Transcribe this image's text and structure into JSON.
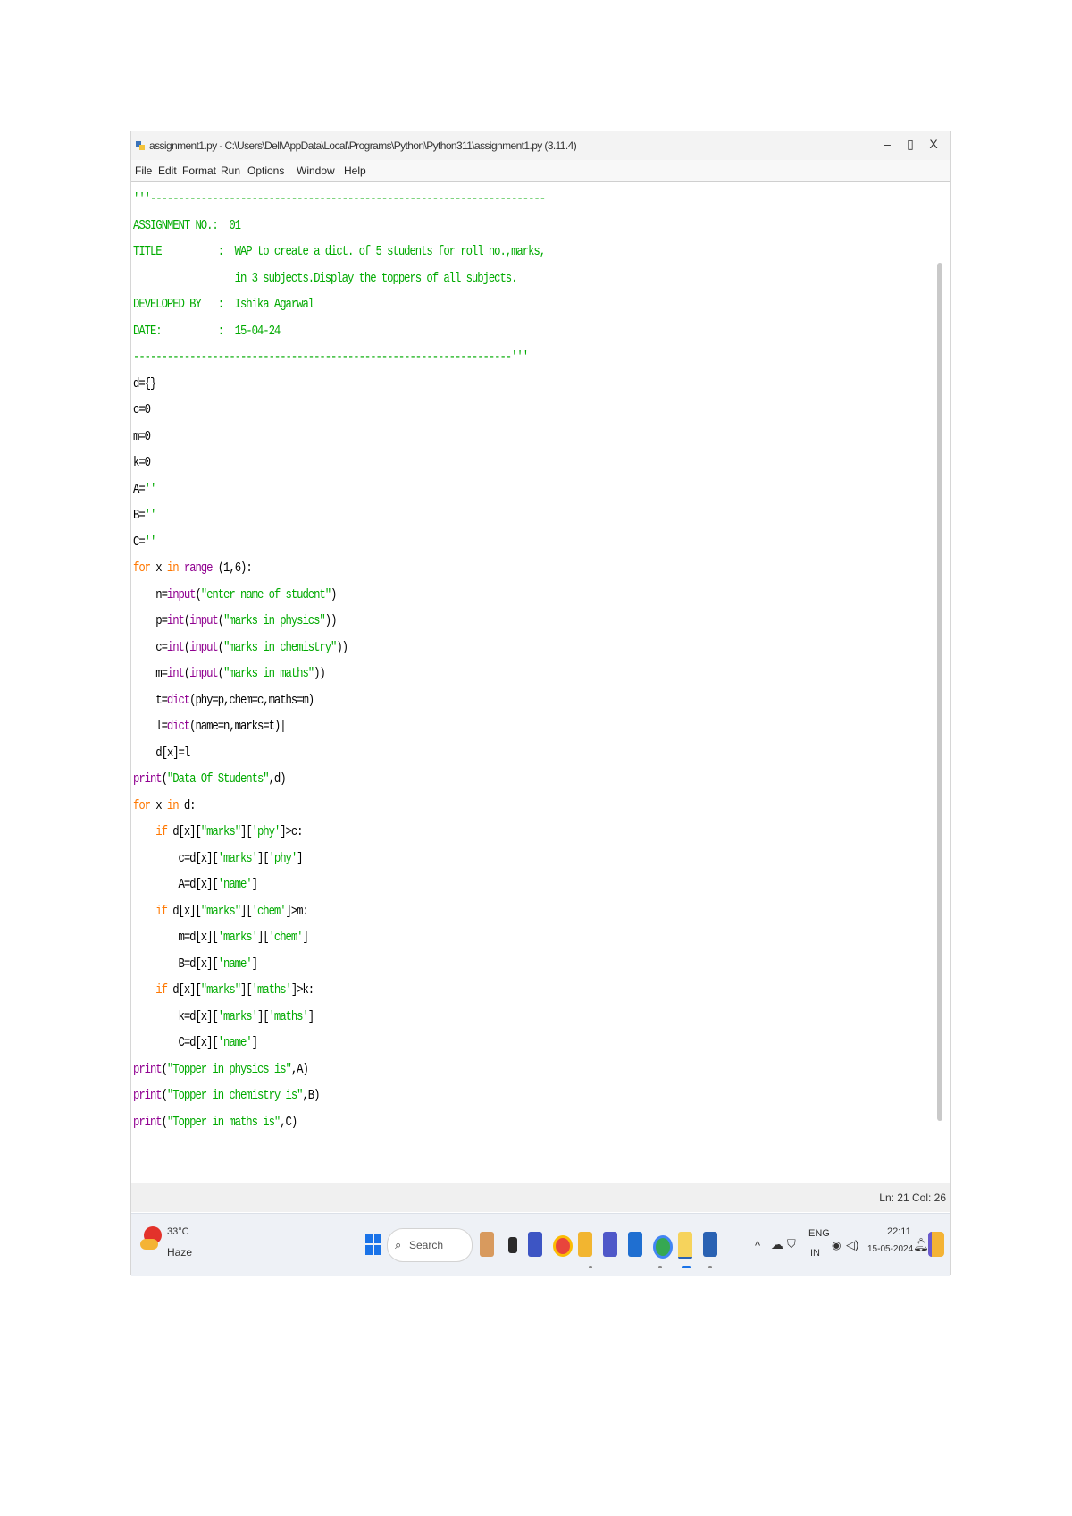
{
  "window": {
    "title": "assignment1.py - C:\\Users\\Dell\\AppData\\Local\\Programs\\Python\\Python311\\assignment1.py (3.11.4)",
    "controls": {
      "minimize": "–",
      "maximize": "▯",
      "close": "X"
    }
  },
  "menu": [
    "File",
    "Edit",
    "Format",
    "Run",
    "Options",
    "Window",
    "Help"
  ],
  "status": {
    "position": "Ln: 21  Col: 26"
  },
  "taskbar": {
    "weather_temp": "33°C",
    "weather_condition": "Haze",
    "search_placeholder": "Search",
    "lang_top": "ENG",
    "lang_bottom": "IN",
    "time": "22:11",
    "date": "15-05-2024"
  },
  "code_lines": [
    [
      [
        "st",
        "'''----------------------------------------------------------------------"
      ]
    ],
    [
      [
        "st",
        "ASSIGNMENT NO.:  01"
      ]
    ],
    [
      [
        "st",
        "TITLE          :  WAP to create a dict. of 5 students for roll no.,marks,"
      ]
    ],
    [
      [
        "st",
        "                  in 3 subjects.Display the toppers of all subjects."
      ]
    ],
    [
      [
        "st",
        "DEVELOPED BY   :  Ishika Agarwal"
      ]
    ],
    [
      [
        "st",
        "DATE:          :  15-04-24"
      ]
    ],
    [
      [
        "st",
        "-------------------------------------------------------------------'''"
      ]
    ],
    [
      [
        "",
        "d={}"
      ]
    ],
    [
      [
        "",
        "c=0"
      ]
    ],
    [
      [
        "",
        "m=0"
      ]
    ],
    [
      [
        "",
        "k=0"
      ]
    ],
    [
      [
        "",
        "A="
      ],
      [
        "st",
        "''"
      ]
    ],
    [
      [
        "",
        "B="
      ],
      [
        "st",
        "''"
      ]
    ],
    [
      [
        "",
        "C="
      ],
      [
        "st",
        "''"
      ]
    ],
    [
      [
        "kw",
        "for"
      ],
      [
        "",
        " x "
      ],
      [
        "kw",
        "in"
      ],
      [
        "",
        " "
      ],
      [
        "bi",
        "range"
      ],
      [
        "",
        " (1,6):"
      ]
    ],
    [
      [
        "",
        "    n="
      ],
      [
        "bi",
        "input"
      ],
      [
        "",
        "("
      ],
      [
        "st",
        "\"enter name of student\""
      ],
      [
        "",
        ")"
      ]
    ],
    [
      [
        "",
        "    p="
      ],
      [
        "bi",
        "int"
      ],
      [
        "",
        "("
      ],
      [
        "bi",
        "input"
      ],
      [
        "",
        "("
      ],
      [
        "st",
        "\"marks in physics\""
      ],
      [
        "",
        "))"
      ]
    ],
    [
      [
        "",
        "    c="
      ],
      [
        "bi",
        "int"
      ],
      [
        "",
        "("
      ],
      [
        "bi",
        "input"
      ],
      [
        "",
        "("
      ],
      [
        "st",
        "\"marks in chemistry\""
      ],
      [
        "",
        "))"
      ]
    ],
    [
      [
        "",
        "    m="
      ],
      [
        "bi",
        "int"
      ],
      [
        "",
        "("
      ],
      [
        "bi",
        "input"
      ],
      [
        "",
        "("
      ],
      [
        "st",
        "\"marks in maths\""
      ],
      [
        "",
        "))"
      ]
    ],
    [
      [
        "",
        "    t="
      ],
      [
        "bi",
        "dict"
      ],
      [
        "",
        "(phy=p,chem=c,maths=m)"
      ]
    ],
    [
      [
        "",
        "    l="
      ],
      [
        "bi",
        "dict"
      ],
      [
        "",
        "(name=n,marks=t)|"
      ]
    ],
    [
      [
        "",
        "    d[x]=l"
      ]
    ],
    [
      [
        "bi",
        "print"
      ],
      [
        "",
        "("
      ],
      [
        "st",
        "\"Data Of Students\""
      ],
      [
        "",
        ",d)"
      ]
    ],
    [
      [
        "kw",
        "for"
      ],
      [
        "",
        " x "
      ],
      [
        "kw",
        "in"
      ],
      [
        "",
        " d:"
      ]
    ],
    [
      [
        "",
        "    "
      ],
      [
        "kw",
        "if"
      ],
      [
        "",
        " d[x]["
      ],
      [
        "st",
        "\"marks\""
      ],
      [
        "",
        "]["
      ],
      [
        "st",
        "'phy'"
      ],
      [
        "",
        "]>c:"
      ]
    ],
    [
      [
        "",
        "        c=d[x]["
      ],
      [
        "st",
        "'marks'"
      ],
      [
        "",
        "]["
      ],
      [
        "st",
        "'phy'"
      ],
      [
        "",
        "]"
      ]
    ],
    [
      [
        "",
        "        A=d[x]["
      ],
      [
        "st",
        "'name'"
      ],
      [
        "",
        "]"
      ]
    ],
    [
      [
        "",
        "    "
      ],
      [
        "kw",
        "if"
      ],
      [
        "",
        " d[x]["
      ],
      [
        "st",
        "\"marks\""
      ],
      [
        "",
        "]["
      ],
      [
        "st",
        "'chem'"
      ],
      [
        "",
        "]>m:"
      ]
    ],
    [
      [
        "",
        "        m=d[x]["
      ],
      [
        "st",
        "'marks'"
      ],
      [
        "",
        "]["
      ],
      [
        "st",
        "'chem'"
      ],
      [
        "",
        "]"
      ]
    ],
    [
      [
        "",
        "        B=d[x]["
      ],
      [
        "st",
        "'name'"
      ],
      [
        "",
        "]"
      ]
    ],
    [
      [
        "",
        "    "
      ],
      [
        "kw",
        "if"
      ],
      [
        "",
        " d[x]["
      ],
      [
        "st",
        "\"marks\""
      ],
      [
        "",
        "]["
      ],
      [
        "st",
        "'maths'"
      ],
      [
        "",
        "]>k:"
      ]
    ],
    [
      [
        "",
        "        k=d[x]["
      ],
      [
        "st",
        "'marks'"
      ],
      [
        "",
        "]["
      ],
      [
        "st",
        "'maths'"
      ],
      [
        "",
        "]"
      ]
    ],
    [
      [
        "",
        "        C=d[x]["
      ],
      [
        "st",
        "'name'"
      ],
      [
        "",
        "]"
      ]
    ],
    [
      [
        "bi",
        "print"
      ],
      [
        "",
        "("
      ],
      [
        "st",
        "\"Topper in physics is\""
      ],
      [
        "",
        ",A)"
      ]
    ],
    [
      [
        "bi",
        "print"
      ],
      [
        "",
        "("
      ],
      [
        "st",
        "\"Topper in chemistry is\""
      ],
      [
        "",
        ",B)"
      ]
    ],
    [
      [
        "bi",
        "print"
      ],
      [
        "",
        "("
      ],
      [
        "st",
        "\"Topper in maths is\""
      ],
      [
        "",
        ",C)"
      ]
    ]
  ]
}
